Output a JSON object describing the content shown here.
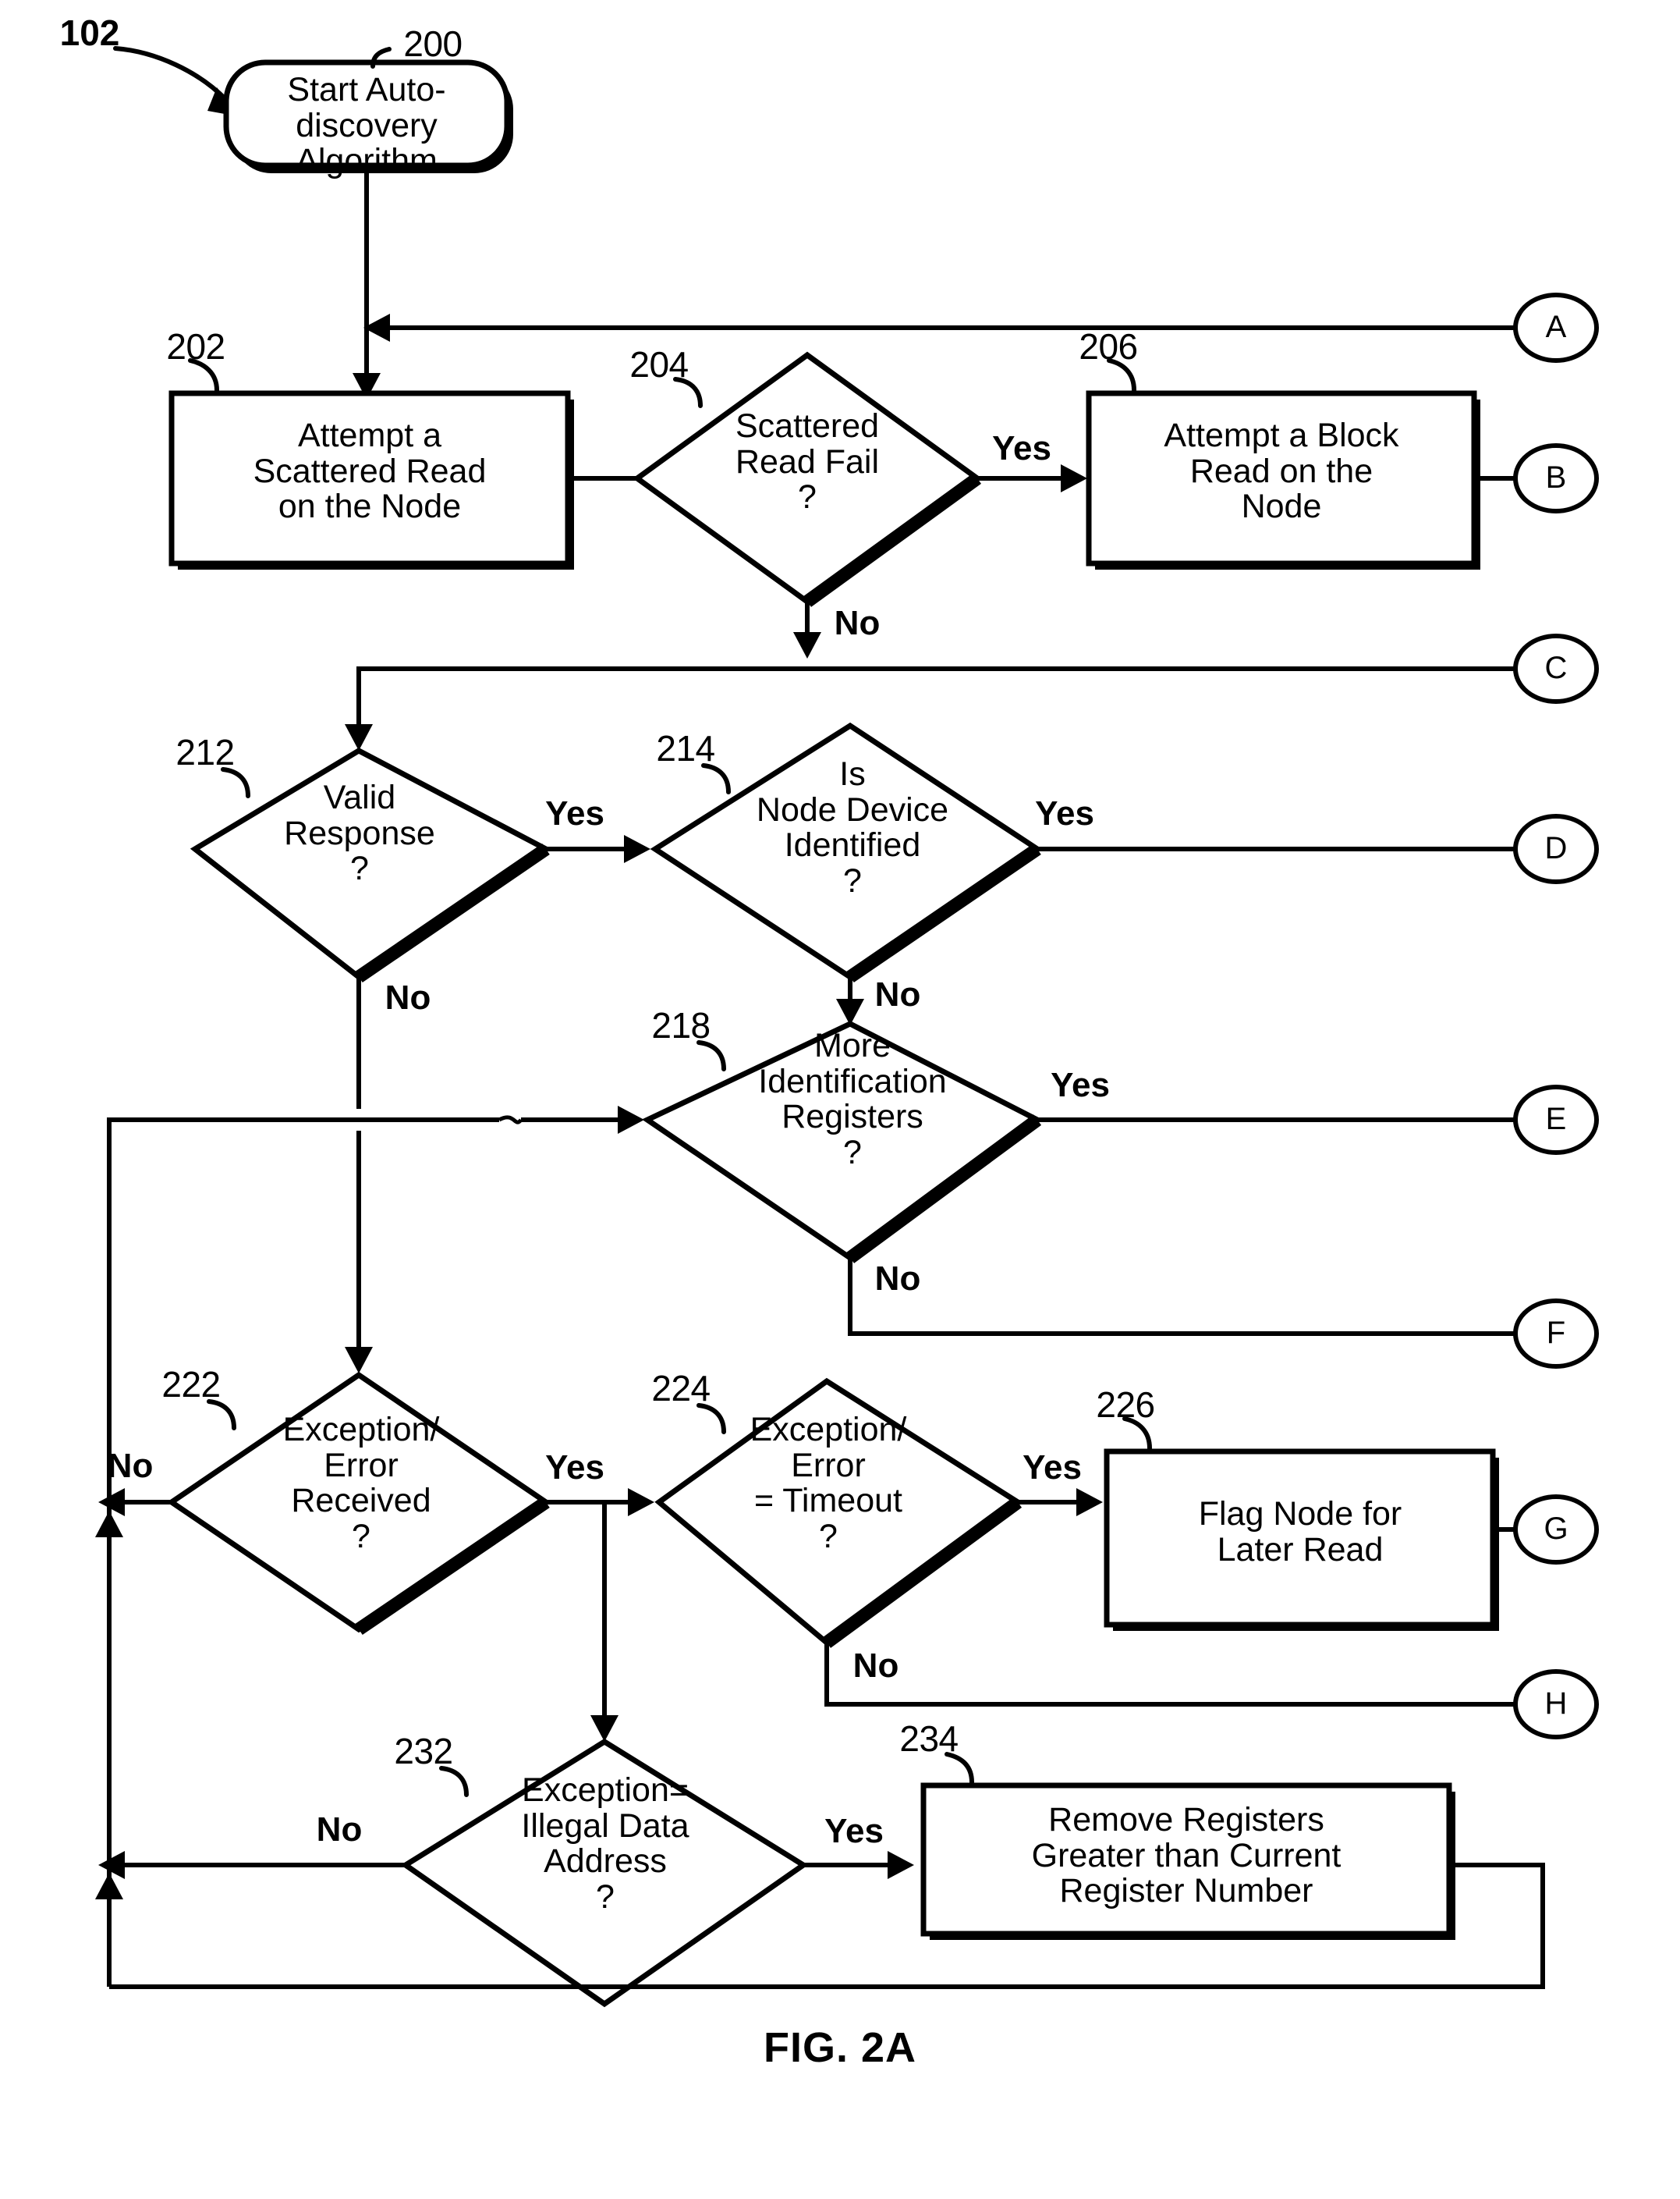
{
  "figure": {
    "caption": "FIG. 2A",
    "root_ref": "102"
  },
  "nodes": [
    {
      "ref": "200",
      "shape": "terminator",
      "text": "Start Auto-\ndiscovery\nAlgorithm"
    },
    {
      "ref": "202",
      "shape": "process",
      "text": "Attempt a\nScattered Read\non the Node"
    },
    {
      "ref": "204",
      "shape": "decision",
      "text": "Scattered\nRead Fail\n?"
    },
    {
      "ref": "206",
      "shape": "process",
      "text": "Attempt a Block\nRead on the\nNode"
    },
    {
      "ref": "212",
      "shape": "decision",
      "text": "Valid\nResponse\n?"
    },
    {
      "ref": "214",
      "shape": "decision",
      "text": "Is\nNode Device\nIdentified\n?"
    },
    {
      "ref": "218",
      "shape": "decision",
      "text": "More\nIdentification\nRegisters\n?"
    },
    {
      "ref": "222",
      "shape": "decision",
      "text": "Exception/\nError\nReceived\n?"
    },
    {
      "ref": "224",
      "shape": "decision",
      "text": "Exception/\nError\n= Timeout\n?"
    },
    {
      "ref": "226",
      "shape": "process",
      "text": "Flag Node for\nLater Read"
    },
    {
      "ref": "232",
      "shape": "decision",
      "text": "Exception=\nIllegal Data\nAddress\n?"
    },
    {
      "ref": "234",
      "shape": "process",
      "text": "Remove Registers\nGreater than Current\nRegister Number"
    }
  ],
  "branch_labels": {
    "d204_yes": "Yes",
    "d204_no": "No",
    "d212_yes": "Yes",
    "d212_no": "No",
    "d214_yes": "Yes",
    "d214_no": "No",
    "d218_yes": "Yes",
    "d218_no": "No",
    "d222_yes": "Yes",
    "d222_no": "No",
    "d224_yes": "Yes",
    "d224_no": "No",
    "d232_yes": "Yes",
    "d232_no": "No"
  },
  "connectors": [
    {
      "id": "A",
      "label": "A"
    },
    {
      "id": "B",
      "label": "B"
    },
    {
      "id": "C",
      "label": "C"
    },
    {
      "id": "D",
      "label": "D"
    },
    {
      "id": "E",
      "label": "E"
    },
    {
      "id": "F",
      "label": "F"
    },
    {
      "id": "G",
      "label": "G"
    },
    {
      "id": "H",
      "label": "H"
    }
  ],
  "colors": {
    "ink": "#000000",
    "paper": "#ffffff"
  }
}
